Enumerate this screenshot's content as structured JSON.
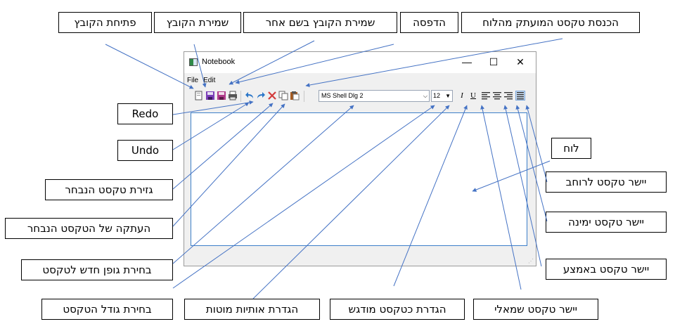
{
  "window": {
    "title": "Notebook",
    "controls": {
      "minimize": "—",
      "maximize": "☐",
      "close": "✕"
    },
    "menu": [
      "File",
      "Edit"
    ],
    "font_name": "MS Shell Dlg 2",
    "font_size": "12",
    "format_glyphs": {
      "italic": "I",
      "underline": "U"
    }
  },
  "callouts": {
    "open_file": "פתיחת הקובץ",
    "save_file": "שמירת הקובץ",
    "save_as": "שמירת הקובץ בשם אחר",
    "print": "הדפסה",
    "paste": "הכנסת טקסט המועתק מהלוח",
    "redo": "Redo",
    "undo": "Undo",
    "cut": "גזירת טקסט הנבחר",
    "copy": "העתקה של הטקסט הנבחר",
    "font": "בחירת גופן חדש לטקסט",
    "font_size": "בחירת גודל הטקסט",
    "italic": "הגדרת אותיות מוטות",
    "bold": "הגדרת כטקסט מודגש",
    "align_left": "יישר טקסט שמאלי",
    "board": "לוח",
    "justify": "יישר טקסט לרוחב",
    "align_right": "יישר טקסט ימינה",
    "align_center": "יישר טקסט באמצע"
  },
  "colors": {
    "arrow": "#4472c4",
    "editor_border": "#3c7fc9",
    "accent_blue": "#1e74d0"
  }
}
